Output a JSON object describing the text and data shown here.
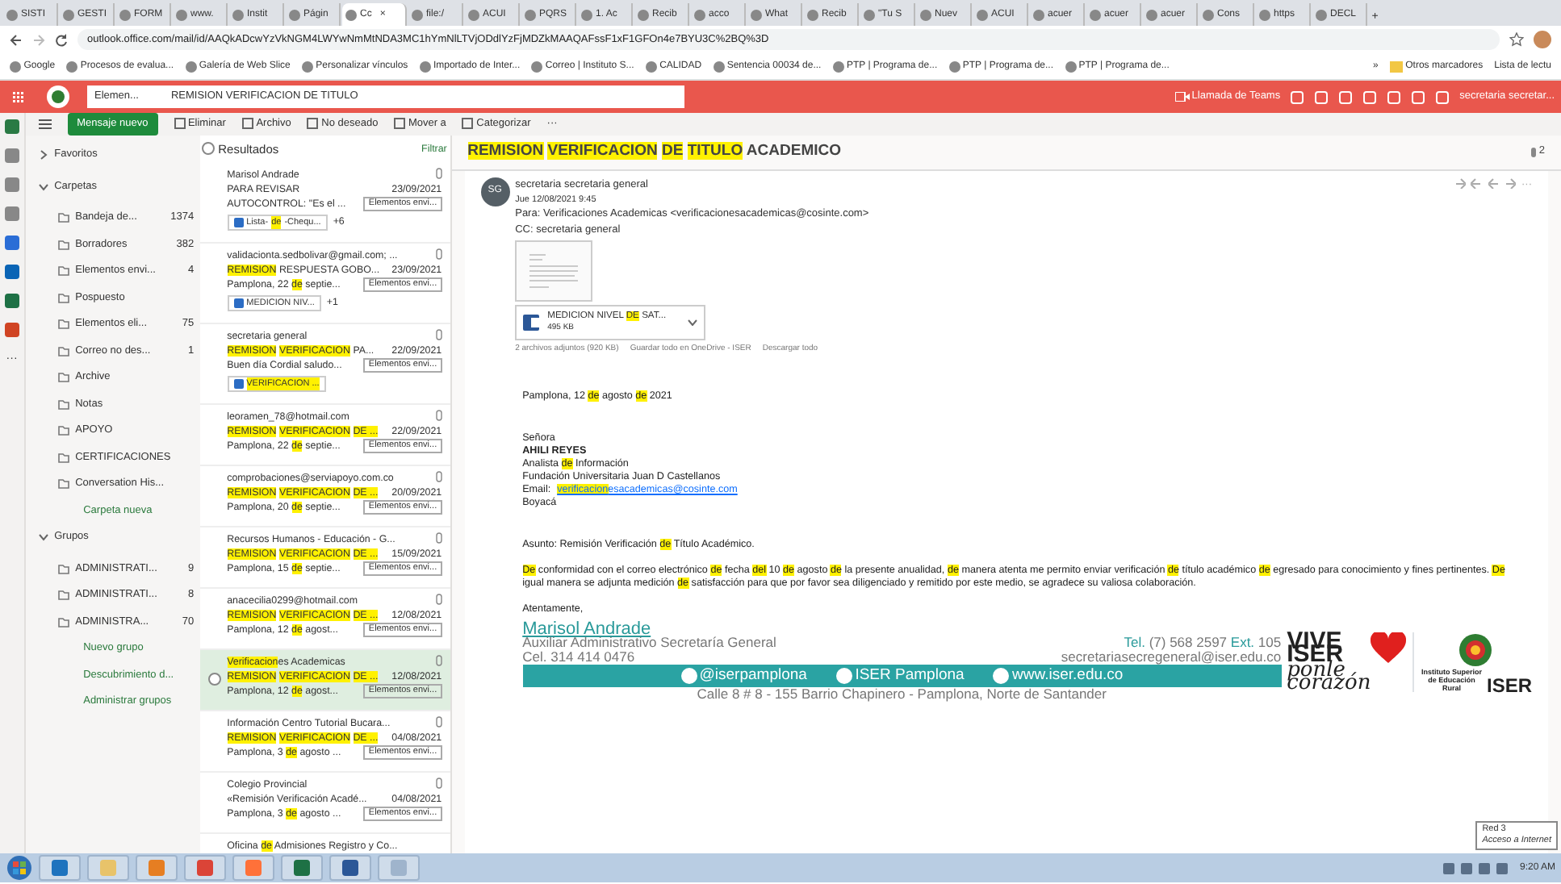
{
  "browser": {
    "tabs": [
      {
        "label": "SISTI",
        "selected": false
      },
      {
        "label": "GESTI",
        "selected": false
      },
      {
        "label": "FORM",
        "selected": false
      },
      {
        "label": "www.",
        "selected": false
      },
      {
        "label": "Instit",
        "selected": false
      },
      {
        "label": "Págin",
        "selected": false
      },
      {
        "label": "Cc",
        "selected": true
      },
      {
        "label": "file:/",
        "selected": false
      },
      {
        "label": "ACUI",
        "selected": false
      },
      {
        "label": "PQRS",
        "selected": false
      },
      {
        "label": "1. Ac",
        "selected": false
      },
      {
        "label": "Recib",
        "selected": false
      },
      {
        "label": "acco",
        "selected": false
      },
      {
        "label": "What",
        "selected": false
      },
      {
        "label": "Recib",
        "selected": false
      },
      {
        "label": "\"Tu S",
        "selected": false
      },
      {
        "label": "Nuev",
        "selected": false
      },
      {
        "label": "ACUI",
        "selected": false
      },
      {
        "label": "acuer",
        "selected": false
      },
      {
        "label": "acuer",
        "selected": false
      },
      {
        "label": "acuer",
        "selected": false
      },
      {
        "label": "Cons",
        "selected": false
      },
      {
        "label": "https",
        "selected": false
      },
      {
        "label": "DECL",
        "selected": false
      }
    ],
    "close_glyph": "×",
    "new_tab_glyph": "+",
    "address": "outlook.office.com/mail/id/AAQkADcwYzVkNGM4LWYwNmMtNDA3MC1hYmNlLTVjODdlYzFjMDZkMAAQAFssF1xF1GFOn4e7BYU3C%2BQ%3D",
    "bookmarks": [
      "Google",
      "Procesos de evalua...",
      "Galería de Web Slice",
      "Personalizar vínculos",
      "Importado de Inter...",
      "Correo | Instituto S...",
      "CALIDAD",
      "Sentencia 00034 de...",
      "PTP | Programa de...",
      "PTP | Programa de...",
      "PTP | Programa de..."
    ],
    "bookmarks_more": "»",
    "other_bookmarks": "Otros marcadores",
    "reading_list": "Lista de lectu"
  },
  "header": {
    "scope": "Elemen...",
    "search": "REMISION VERIFICACION DE TITULO",
    "teams": "Llamada de Teams",
    "user": "secretaria secretar..."
  },
  "toolbar": {
    "new_message": "Mensaje nuevo",
    "actions": [
      "Eliminar",
      "Archivo",
      "No deseado",
      "Mover a",
      "Categorizar"
    ],
    "more": "···"
  },
  "folders": [
    {
      "label": "Favoritos",
      "expanded": false
    },
    {
      "label": "Carpetas",
      "expanded": true,
      "children": [
        {
          "label": "Bandeja de...",
          "count": "1374"
        },
        {
          "label": "Borradores",
          "count": "382"
        },
        {
          "label": "Elementos envi...",
          "count": "4"
        },
        {
          "label": "Pospuesto"
        },
        {
          "label": "Elementos eli...",
          "count": "75"
        },
        {
          "label": "Correo no des...",
          "count": "1"
        },
        {
          "label": "Archive"
        },
        {
          "label": "Notas"
        },
        {
          "label": "APOYO"
        },
        {
          "label": "CERTIFICACIONES"
        },
        {
          "label": "Conversation His..."
        },
        {
          "label": "Carpeta nueva",
          "kind": "link"
        }
      ]
    },
    {
      "label": "Grupos",
      "expanded": true,
      "children": [
        {
          "label": "ADMINISTRATI...",
          "count": "9"
        },
        {
          "label": "ADMINISTRATI...",
          "count": "8"
        },
        {
          "label": "ADMINISTRA...",
          "count": "70"
        },
        {
          "label": "Nuevo grupo",
          "kind": "link"
        },
        {
          "label": "Descubrimiento d...",
          "kind": "link"
        },
        {
          "label": "Administrar grupos",
          "kind": "link"
        }
      ]
    }
  ],
  "list": {
    "title": "Resultados",
    "filter": "Filtrar",
    "messages": [
      {
        "sender": [
          {
            "text": "Marisol Andrade",
            "hl": false
          }
        ],
        "subject": [
          {
            "text": "PARA REVISAR",
            "hl": false
          }
        ],
        "date": "23/09/2021",
        "preview": [
          {
            "text": "AUTOCONTROL: \"Es el ...",
            "hl": false
          }
        ],
        "folder": "Elementos envi...",
        "attachment": [
          {
            "text": "Lista-",
            "hl": false
          },
          {
            "text": "de",
            "hl": true
          },
          {
            "text": "-Chequ...",
            "hl": false
          }
        ],
        "more": "+6",
        "selected": false
      },
      {
        "sender": [
          {
            "text": "validacionta.sedbolivar@gmail.com; ...",
            "hl": false
          }
        ],
        "subject": [
          {
            "text": "REMISION",
            "hl": true
          },
          {
            "text": " RESPUESTA GOBO...",
            "hl": false
          }
        ],
        "date": "23/09/2021",
        "preview": [
          {
            "text": "Pamplona, 22 ",
            "hl": false
          },
          {
            "text": "de",
            "hl": true
          },
          {
            "text": " septie...",
            "hl": false
          }
        ],
        "folder": "Elementos envi...",
        "attachment": [
          {
            "text": "MEDICION NIV...",
            "hl": false
          }
        ],
        "more": "+1",
        "selected": false
      },
      {
        "sender": [
          {
            "text": "secretaria general",
            "hl": false
          }
        ],
        "subject": [
          {
            "text": "REMISION ",
            "hl": true
          },
          {
            "text": "VERIFICACION",
            "hl": true
          },
          {
            "text": " PA...",
            "hl": false
          }
        ],
        "date": "22/09/2021",
        "preview": [
          {
            "text": "Buen día Cordial saludo...",
            "hl": false
          }
        ],
        "folder": "Elementos envi...",
        "attachment": [
          {
            "text": "VERIFICACION ...",
            "hl": true
          }
        ],
        "selected": false
      },
      {
        "sender": [
          {
            "text": "leoramen_78@hotmail.com",
            "hl": false
          }
        ],
        "subject": [
          {
            "text": "REMISION ",
            "hl": true
          },
          {
            "text": "VERIFICACION ",
            "hl": true
          },
          {
            "text": "DE ...",
            "hl": true
          }
        ],
        "date": "22/09/2021",
        "preview": [
          {
            "text": "Pamplona, 22 ",
            "hl": false
          },
          {
            "text": "de",
            "hl": true
          },
          {
            "text": " septie...",
            "hl": false
          }
        ],
        "folder": "Elementos envi...",
        "selected": false
      },
      {
        "sender": [
          {
            "text": "comprobaciones@serviapoyo.com.co",
            "hl": false
          }
        ],
        "subject": [
          {
            "text": "REMISION ",
            "hl": true
          },
          {
            "text": "VERIFICACION ",
            "hl": true
          },
          {
            "text": "DE ...",
            "hl": true
          }
        ],
        "date": "20/09/2021",
        "preview": [
          {
            "text": "Pamplona, 20 ",
            "hl": false
          },
          {
            "text": "de",
            "hl": true
          },
          {
            "text": " septie...",
            "hl": false
          }
        ],
        "folder": "Elementos envi...",
        "selected": false
      },
      {
        "sender": [
          {
            "text": "Recursos Humanos - Educación - G...",
            "hl": false
          }
        ],
        "subject": [
          {
            "text": "REMISION ",
            "hl": true
          },
          {
            "text": "VERIFICACION ",
            "hl": true
          },
          {
            "text": "DE ...",
            "hl": true
          }
        ],
        "date": "15/09/2021",
        "preview": [
          {
            "text": "Pamplona, 15 ",
            "hl": false
          },
          {
            "text": "de",
            "hl": true
          },
          {
            "text": " septie...",
            "hl": false
          }
        ],
        "folder": "Elementos envi...",
        "selected": false
      },
      {
        "sender": [
          {
            "text": "anacecilia0299@hotmail.com",
            "hl": false
          }
        ],
        "subject": [
          {
            "text": "REMISION ",
            "hl": true
          },
          {
            "text": "VERIFICACION ",
            "hl": true
          },
          {
            "text": "DE ...",
            "hl": true
          }
        ],
        "date": "12/08/2021",
        "preview": [
          {
            "text": "Pamplona, 12 ",
            "hl": false
          },
          {
            "text": "de",
            "hl": true
          },
          {
            "text": " agost...",
            "hl": false
          }
        ],
        "folder": "Elementos envi...",
        "selected": false
      },
      {
        "sender": [
          {
            "text": "Verificacion",
            "hl": true
          },
          {
            "text": "es Academicas",
            "hl": false
          }
        ],
        "subject": [
          {
            "text": "REMISION ",
            "hl": true
          },
          {
            "text": "VERIFICACION ",
            "hl": true
          },
          {
            "text": "DE ...",
            "hl": true
          }
        ],
        "date": "12/08/2021",
        "preview": [
          {
            "text": "Pamplona, 12 ",
            "hl": false
          },
          {
            "text": "de",
            "hl": true
          },
          {
            "text": " agost...",
            "hl": false
          }
        ],
        "folder": "Elementos envi...",
        "selected": true
      },
      {
        "sender": [
          {
            "text": "Información Centro Tutorial Bucara...",
            "hl": false
          }
        ],
        "subject": [
          {
            "text": "REMISION ",
            "hl": true
          },
          {
            "text": "VERIFICACION ",
            "hl": true
          },
          {
            "text": "DE ...",
            "hl": true
          }
        ],
        "date": "04/08/2021",
        "preview": [
          {
            "text": "Pamplona, 3 ",
            "hl": false
          },
          {
            "text": "de",
            "hl": true
          },
          {
            "text": " agosto ...",
            "hl": false
          }
        ],
        "folder": "Elementos envi...",
        "selected": false
      },
      {
        "sender": [
          {
            "text": "Colegio Provincial",
            "hl": false
          }
        ],
        "subject": [
          {
            "text": "«Remisión Verificación Acadé...",
            "hl": false
          }
        ],
        "date": "04/08/2021",
        "preview": [
          {
            "text": "Pamplona, 3 ",
            "hl": false
          },
          {
            "text": "de",
            "hl": true
          },
          {
            "text": " agosto ...",
            "hl": false
          }
        ],
        "folder": "Elementos envi...",
        "selected": false
      },
      {
        "sender": [
          {
            "text": "Oficina ",
            "hl": false
          },
          {
            "text": "de",
            "hl": true
          },
          {
            "text": " Admisiones Registro y Co...",
            "hl": false
          }
        ],
        "selected": false
      }
    ]
  },
  "reading": {
    "subject": [
      {
        "text": "REMISION ",
        "hl": true
      },
      {
        "text": "VERIFICACION ",
        "hl": true
      },
      {
        "text": "DE ",
        "hl": true
      },
      {
        "text": "TITULO",
        "hl": true
      },
      {
        "text": " ACADEMICO",
        "hl": false
      }
    ],
    "count": "2",
    "avatar": "SG",
    "from": "secretaria secretaria general",
    "date": "Jue 12/08/2021 9:45",
    "to": "Para: Verificaciones Academicas <verificacionesacademicas@cosinte.com>",
    "cc": "CC: secretaria general",
    "attachment": {
      "name": [
        {
          "text": "MEDICION NIVEL ",
          "hl": false
        },
        {
          "text": "DE",
          "hl": true
        },
        {
          "text": " SAT...",
          "hl": false
        }
      ],
      "size": "495 KB"
    },
    "attach_summary": "2 archivos adjuntos (920 KB)",
    "save_all": "Guardar todo en OneDrive - ISER",
    "download_all": "Descargar todo",
    "place_date": [
      {
        "text": "Pamplona, 12 ",
        "hl": false
      },
      {
        "text": "de",
        "hl": true
      },
      {
        "text": " agosto  ",
        "hl": false
      },
      {
        "text": "de",
        "hl": true
      },
      {
        "text": " 2021",
        "hl": false
      }
    ],
    "recipient": [
      {
        "kind": "text",
        "parts": [
          {
            "text": "Señora",
            "hl": false
          }
        ]
      },
      {
        "kind": "bold",
        "parts": [
          {
            "text": "AHILI REYES",
            "hl": false
          }
        ]
      },
      {
        "kind": "text",
        "parts": [
          {
            "text": "Analista ",
            "hl": false
          },
          {
            "text": "de",
            "hl": true
          },
          {
            "text": " Información",
            "hl": false
          }
        ]
      },
      {
        "kind": "text",
        "parts": [
          {
            "text": "Fundación Universitaria Juan D Castellanos",
            "hl": false
          }
        ]
      },
      {
        "kind": "email",
        "label": "Email:",
        "parts": [
          {
            "text": "verificacion",
            "hl": true
          },
          {
            "text": "esacademicas@cosinte.com",
            "hl": false
          }
        ]
      },
      {
        "kind": "text",
        "parts": [
          {
            "text": "Boyacá",
            "hl": false
          }
        ]
      }
    ],
    "subject_line": [
      {
        "text": "Asunto: Remisión Verificación ",
        "hl": false
      },
      {
        "text": "de",
        "hl": true
      },
      {
        "text": " Título Académico.",
        "hl": false
      }
    ],
    "paragraph": [
      {
        "text": "De",
        "hl": true
      },
      {
        "text": " conformidad con el correo electrónico ",
        "hl": false
      },
      {
        "text": "de",
        "hl": true
      },
      {
        "text": " fecha ",
        "hl": false
      },
      {
        "text": "del",
        "hl": true
      },
      {
        "text": " 10 ",
        "hl": false
      },
      {
        "text": "de",
        "hl": true
      },
      {
        "text": " agosto ",
        "hl": false
      },
      {
        "text": "de",
        "hl": true
      },
      {
        "text": " la presente anualidad, ",
        "hl": false
      },
      {
        "text": "de",
        "hl": true
      },
      {
        "text": " manera atenta me permito enviar verificación ",
        "hl": false
      },
      {
        "text": "de",
        "hl": true
      },
      {
        "text": " título académico ",
        "hl": false
      },
      {
        "text": "de",
        "hl": true
      },
      {
        "text": " egresado para conocimiento y fines pertinentes.  ",
        "hl": false
      },
      {
        "text": "De",
        "hl": true
      },
      {
        "text": " igual manera se adjunta medición ",
        "hl": false
      },
      {
        "text": "de",
        "hl": true
      },
      {
        "text": " satisfacción para que por favor sea diligenciado y remitido por este medio, se agradece su valiosa colaboración.",
        "hl": false
      }
    ],
    "closing": "Atentamente,",
    "signature": {
      "name": "Marisol Andrade",
      "role": "Auxiliar Administrativo Secretaría General",
      "cel": "Cel. 314 414 0476",
      "tel_label": "Tel.",
      "tel": "(7) 568 2597",
      "ext_label": "Ext.",
      "ext": "105",
      "email": "secretariasecregeneral@iser.edu.co",
      "twitter": "@iserpamplona",
      "facebook": "ISER Pamplona",
      "web": "www.iser.edu.co",
      "address": "Calle 8 # 8 - 155 Barrio Chapinero - Pamplona, Norte de Santander",
      "slogan_top": "VIVE ISER",
      "slogan_bottom": "ponle corazón",
      "institute": "Instituto Superior de Educación Rural",
      "institute_short": "ISER"
    }
  },
  "taskbar": {
    "time": "9:20 AM",
    "tooltip_title": "Red 3",
    "tooltip_text": "Acceso a Internet"
  }
}
